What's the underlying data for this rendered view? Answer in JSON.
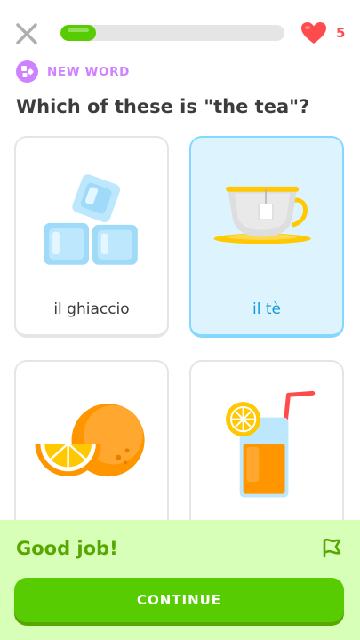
{
  "header": {
    "close_icon": "close-icon",
    "progress_fraction": 0.16,
    "hearts_count": "5",
    "heart_color": "#ff4b4b"
  },
  "challenge": {
    "badge_icon": "new-word-icon",
    "tag": "NEW WORD",
    "question": "Which of these is \"the tea\"?"
  },
  "choices": [
    {
      "label": "il ghiaccio",
      "icon": "ice-cubes-icon",
      "selected": false
    },
    {
      "label": "il tè",
      "icon": "tea-cup-icon",
      "selected": true
    },
    {
      "label": "",
      "icon": "orange-icon",
      "selected": false
    },
    {
      "label": "",
      "icon": "juice-glass-icon",
      "selected": false
    }
  ],
  "feedback": {
    "title": "Good job!",
    "flag_icon": "report-flag-icon",
    "continue_label": "CONTINUE"
  },
  "colors": {
    "accent_green": "#58cc02",
    "feedback_background": "#d7ffb8",
    "feedback_text": "#58a700",
    "selected_border": "#84d8ff",
    "selected_fill": "#ddf4ff",
    "selected_text": "#1899d6",
    "tag_purple": "#ce82ff"
  }
}
